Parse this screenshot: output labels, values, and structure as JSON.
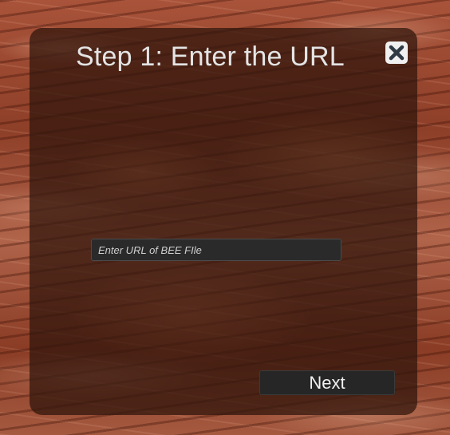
{
  "dialog": {
    "title": "Step 1: Enter the URL",
    "close_icon": "close-x-icon"
  },
  "url_field": {
    "placeholder": "Enter URL of BEE FIle",
    "value": ""
  },
  "next_button": {
    "label": "Next"
  },
  "colors": {
    "panel": "#30160c",
    "input_bg": "#2a2a2a",
    "button_bg": "#262626",
    "text": "#e4e4e4"
  }
}
